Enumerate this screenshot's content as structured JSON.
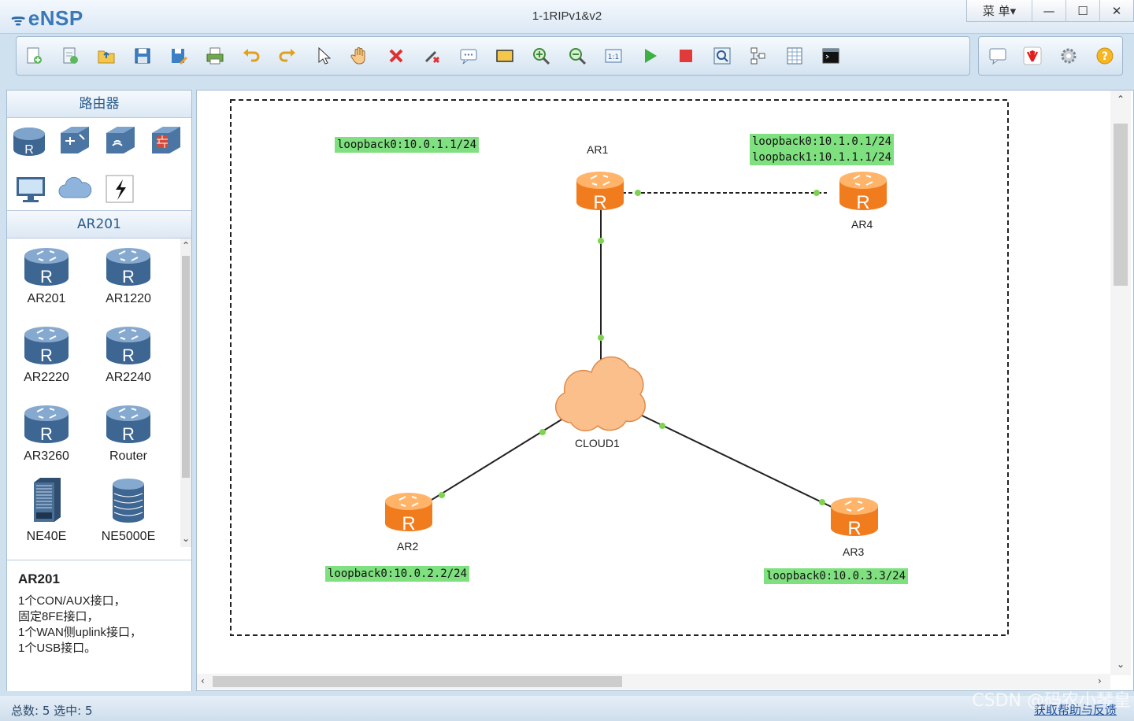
{
  "app": {
    "name": "eNSP",
    "window_title": "1-1RIPv1&v2"
  },
  "window_controls": {
    "menu": "菜 单▾",
    "minimize": "—",
    "maximize": "☐",
    "close": "✕"
  },
  "toolbar": {
    "icons": [
      "new-topology-icon",
      "new-lab-icon",
      "open-icon",
      "save-icon",
      "save-as-icon",
      "print-icon",
      "undo-icon",
      "redo-icon",
      "select-icon",
      "pan-hand-icon",
      "delete-icon",
      "delete-link-icon",
      "text-note-icon",
      "rectangle-icon",
      "zoom-in-icon",
      "zoom-out-icon",
      "fit-view-icon",
      "start-icon",
      "stop-icon",
      "capture-icon",
      "topology-icon",
      "grid-icon",
      "cli-icon"
    ],
    "right_icons": [
      "chat-icon",
      "huawei-icon",
      "settings-icon",
      "help-icon"
    ]
  },
  "left_panel": {
    "category_header": "路由器",
    "subcategory_header": "AR201",
    "category_icons": [
      "router-category-icon",
      "switch-category-icon",
      "wireless-category-icon",
      "firewall-category-icon",
      "terminal-category-icon",
      "cloud-category-icon",
      "connection-category-icon"
    ],
    "devices": [
      {
        "label": "AR201"
      },
      {
        "label": "AR1220"
      },
      {
        "label": "AR2220"
      },
      {
        "label": "AR2240"
      },
      {
        "label": "AR3260"
      },
      {
        "label": "Router"
      },
      {
        "label": "NE40E"
      },
      {
        "label": "NE5000E"
      }
    ],
    "description": {
      "title": "AR201",
      "text": "1个CON/AUX接口，\n固定8FE接口，\n1个WAN侧uplink接口，\n1个USB接口。"
    }
  },
  "topology": {
    "nodes": {
      "ar1": "AR1",
      "ar2": "AR2",
      "ar3": "AR3",
      "ar4": "AR4",
      "cloud1": "CLOUD1"
    },
    "loopbacks": {
      "ar1": "loopback0:10.0.1.1/24",
      "ar4": "loopback0:10.1.0.1/24\nloopback1:10.1.1.1/24",
      "ar2": "loopback0:10.0.2.2/24",
      "ar3": "loopback0:10.0.3.3/24"
    },
    "colors": {
      "router": "#f5862a",
      "link_endpoint": "#7ed34f",
      "loopback_bg": "#7fe07f"
    }
  },
  "status": {
    "text": "总数: 5  选中: 5",
    "help_link": "获取帮助与反馈"
  },
  "watermark": "CSDN @码农小琴皇"
}
